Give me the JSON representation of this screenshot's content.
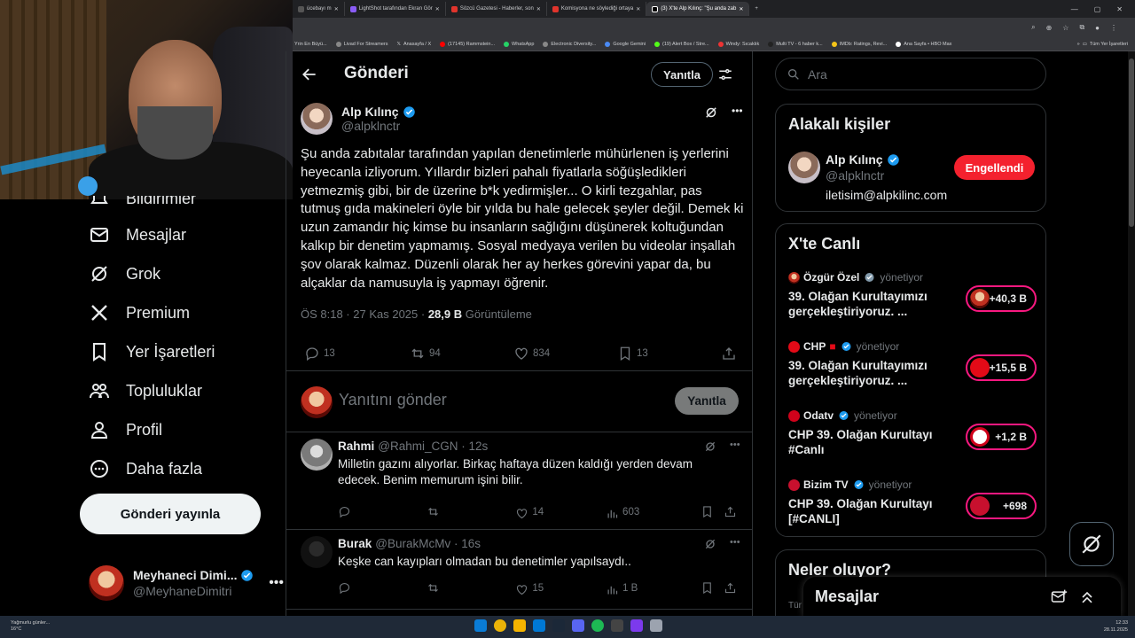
{
  "browser": {
    "tabs": [
      "ücebayı m",
      "LightShot tarafından Ekran Gör",
      "Sözcü Gazetesi - Haberler, son",
      "Komisyona ne söylediği ortaya",
      "(3) X'te Alp Kılınç: \"Şu anda zab"
    ],
    "bookmarks": [
      "Yrin En Büyü...",
      "Livad For Streamers",
      "Anasayfa / X",
      "(17145) Rammstein...",
      "WhatsApp",
      "Electronic Diversity...",
      "Google Gemini",
      "(19) Alert Box / Stre...",
      "Windy: Sıcaklık",
      "Multi TV - 6 haber k...",
      "IMDb: Ratings, Revi...",
      "Ana Sayfa • HBO Max",
      "Tüm Yer İşaretleri"
    ]
  },
  "nav": {
    "partial_label": "Bildirimler",
    "items": [
      {
        "label": "Mesajlar",
        "icon": "mail-icon"
      },
      {
        "label": "Grok",
        "icon": "grok-icon"
      },
      {
        "label": "Premium",
        "icon": "x-logo-icon"
      },
      {
        "label": "Yer İşaretleri",
        "icon": "bookmark-icon"
      },
      {
        "label": "Topluluklar",
        "icon": "communities-icon"
      },
      {
        "label": "Profil",
        "icon": "profile-icon"
      },
      {
        "label": "Daha fazla",
        "icon": "more-circle-icon"
      }
    ],
    "post_button": "Gönderi yayınla"
  },
  "account": {
    "name": "Meyhaneci Dimi...",
    "handle": "@MeyhaneDimitri"
  },
  "header": {
    "title": "Gönderi",
    "reply_button": "Yanıtla"
  },
  "tweet": {
    "author_name": "Alp Kılınç",
    "author_handle": "@alpklnctr",
    "text": "Şu anda zabıtalar tarafından yapılan denetimlerle mühürlenen iş yerlerini heyecanla izliyorum. Yıllardır bizleri pahalı fiyatlarla söğüşledikleri yetmezmiş gibi, bir de üzerine b*k yedirmişler... O kirli tezgahlar, pas tutmuş gıda makineleri öyle bir yılda bu hale gelecek şeyler değil. Demek ki uzun zamandır hiç kimse bu insanların sağlığını düşünerek koltuğundan kalkıp bir denetim yapmamış. Sosyal medyaya verilen bu videolar inşallah şov olarak kalmaz. Düzenli olarak her ay herkes görevini yapar da, bu alçaklar da namusuyla iş yapmayı öğrenir.",
    "time": "ÖS 8:18 · 27 Kas 2025 · ",
    "views": "28,9 B",
    "views_label": " Görüntüleme",
    "replies": "13",
    "reposts": "94",
    "likes": "834",
    "bookmarks": "13"
  },
  "compose": {
    "placeholder": "Yanıtını gönder",
    "button": "Yanıtla"
  },
  "replies": [
    {
      "name": "Rahmi",
      "handle": "@Rahmi_CGN · 12s",
      "text": "Milletin gazını alıyorlar. Birkaç haftaya düzen kaldığı yerden devam edecek. Benim memurum işini bilir.",
      "likes": "14",
      "views": "603"
    },
    {
      "name": "Burak",
      "handle": "@BurakMcMv · 16s",
      "text": "Keşke can kayıpları olmadan bu denetimler yapılsaydı..",
      "likes": "15",
      "views": "1 B"
    }
  ],
  "sidebar": {
    "search_placeholder": "Ara",
    "related": {
      "title": "Alakalı kişiler",
      "name": "Alp Kılınç",
      "handle": "@alpklnctr",
      "bio": "iletisim@alpkilinc.com",
      "button": "Engellendi"
    },
    "live": {
      "title": "X'te Canlı",
      "items": [
        {
          "host": "Özgür Özel",
          "role": "yönetiyor",
          "title": "39. Olağan Kurultayımızı gerçekleştiriyoruz. ...",
          "count": "+40,3 B"
        },
        {
          "host": "CHP",
          "role": "yönetiyor",
          "title": "39. Olağan Kurultayımızı gerçekleştiriyoruz. ...",
          "count": "+15,5 B"
        },
        {
          "host": "Odatv",
          "role": "yönetiyor",
          "title": "CHP 39. Olağan Kurultayı #Canlı",
          "count": "+1,2 B"
        },
        {
          "host": "Bizim TV",
          "role": "yönetiyor",
          "title": "CHP 39. Olağan Kurultayı [#CANLI]",
          "count": "+698"
        }
      ]
    },
    "trending_title": "Neler oluyor?",
    "trending_partial": "Tür"
  },
  "messages_drawer": {
    "title": "Mesajlar"
  },
  "taskbar": {
    "weather": "Yağmurlu günler...",
    "temp": "16°C",
    "time": "12:33",
    "date": "28.11.2025"
  },
  "colors": {
    "accent": "#1d9bf0",
    "danger": "#f4212e",
    "live": "#f91880"
  }
}
